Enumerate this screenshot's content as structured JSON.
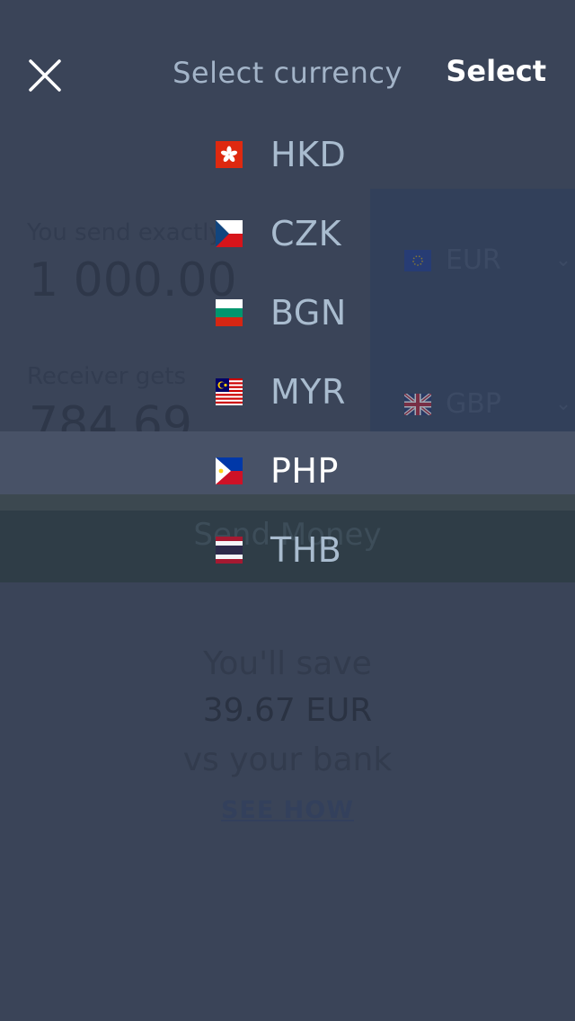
{
  "header": {
    "title": "Select currency",
    "select_label": "Select"
  },
  "background": {
    "send_label": "You send exactly",
    "send_amount": "1 000.00",
    "receive_label": "Receiver gets",
    "receive_amount": "784.69",
    "from_currency": "EUR",
    "to_currency": "GBP",
    "send_button": "Send Money",
    "savings_line1": "You'll save",
    "savings_amount": "39.67 EUR",
    "savings_line3": "vs your bank",
    "see_how": "SEE HOW"
  },
  "picker": {
    "selected": "PHP",
    "items": [
      {
        "code": "HKD",
        "flag": "hong-kong-flag-icon"
      },
      {
        "code": "CZK",
        "flag": "czech-flag-icon"
      },
      {
        "code": "BGN",
        "flag": "bulgaria-flag-icon"
      },
      {
        "code": "MYR",
        "flag": "malaysia-flag-icon"
      },
      {
        "code": "PHP",
        "flag": "philippines-flag-icon"
      },
      {
        "code": "THB",
        "flag": "thailand-flag-icon"
      }
    ]
  },
  "colors": {
    "background": "#3a4458",
    "title": "#a3b4c8",
    "item_text": "#a9bccf",
    "selected_text": "#ffffff",
    "selected_band": "#485267"
  }
}
